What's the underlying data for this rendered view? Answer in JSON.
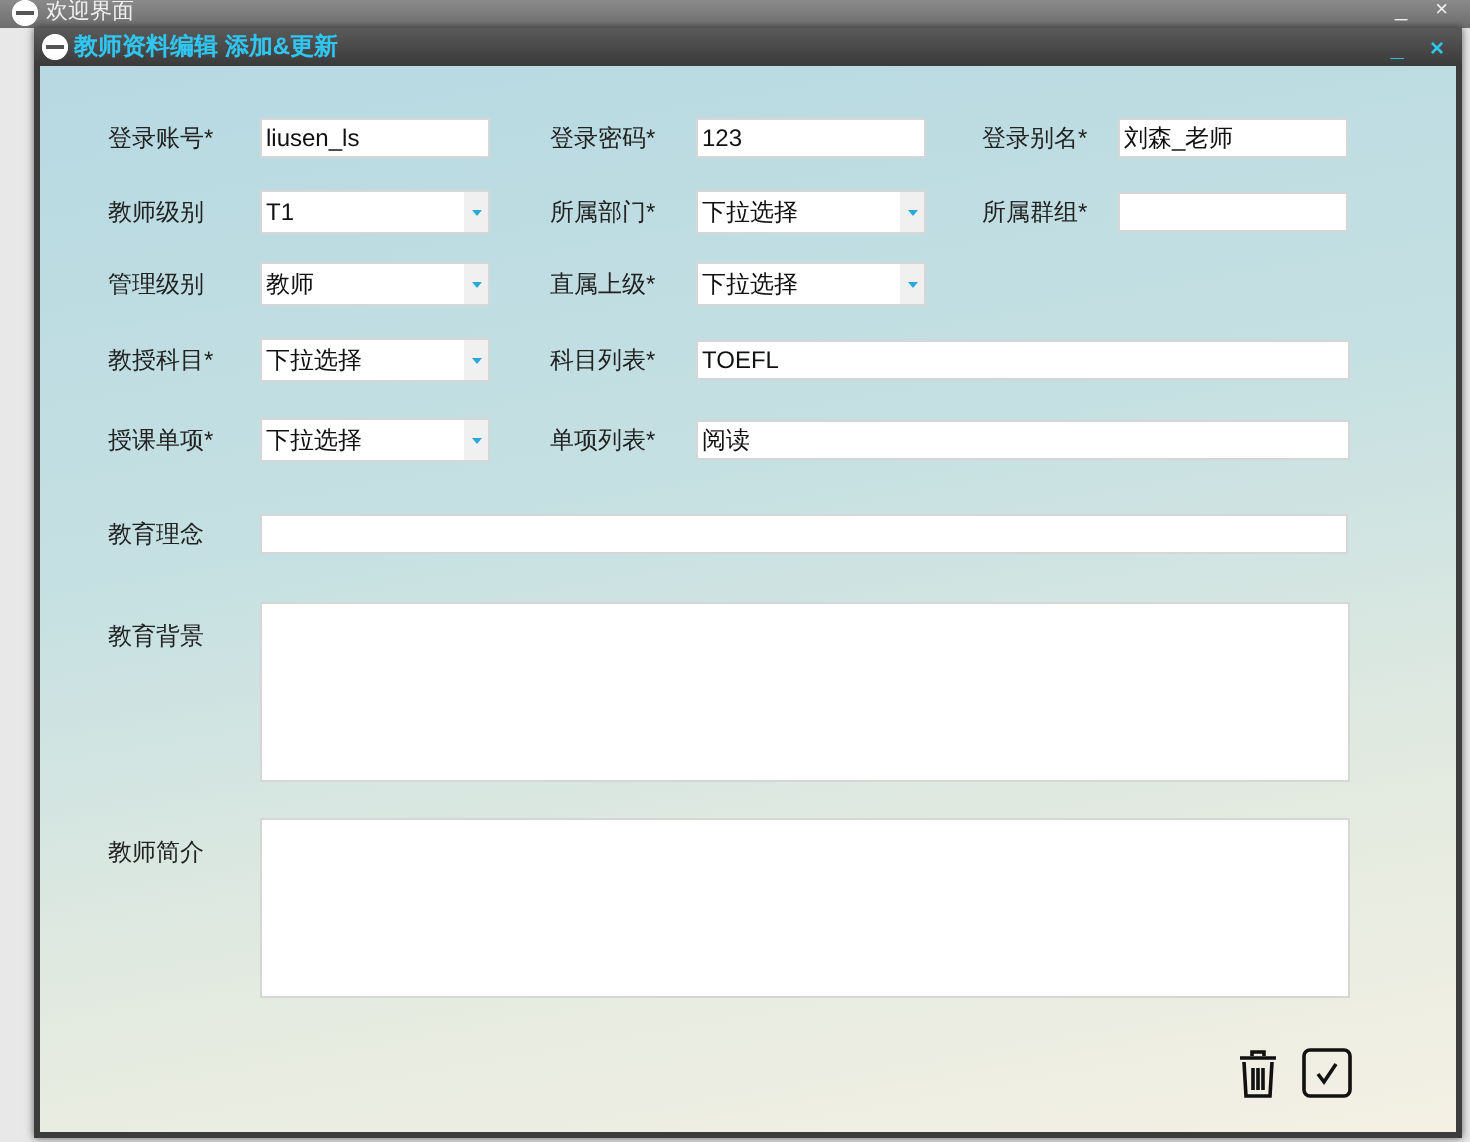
{
  "background_window": {
    "title": "欢迎界面",
    "buttons": [
      "_",
      "×"
    ]
  },
  "window": {
    "title": "教师资料编辑 添加&更新",
    "buttons": [
      "_",
      "×"
    ]
  },
  "rows": [
    [
      {
        "kind": "text",
        "label": "登录账号*",
        "value": "liusen_ls"
      },
      {
        "kind": "text",
        "label": "登录密码*",
        "value": "123"
      },
      {
        "kind": "text",
        "label": "登录别名*",
        "value": "刘森_老师"
      }
    ],
    [
      {
        "kind": "dropdown",
        "label": "教师级别",
        "value": "T1"
      },
      {
        "kind": "dropdown",
        "label": "所属部门*",
        "value": "下拉选择"
      },
      {
        "kind": "text",
        "label": "所属群组*"
      }
    ],
    [
      {
        "kind": "dropdown",
        "label": "管理级别",
        "value": "教师"
      },
      {
        "kind": "dropdown",
        "label": "直属上级*",
        "value": "下拉选择"
      }
    ],
    [
      {
        "kind": "dropdown",
        "label": "教授科目*",
        "value": "下拉选择"
      },
      {
        "kind": "wide_text",
        "label": "科目列表*",
        "value": "TOEFL"
      }
    ],
    [
      {
        "kind": "dropdown",
        "label": "授课单项*",
        "value": "下拉选择"
      },
      {
        "kind": "wide_text",
        "label": "单项列表*",
        "value": "阅读"
      }
    ],
    [
      {
        "kind": "wide_text",
        "label": "教育理念"
      }
    ],
    [
      {
        "kind": "textarea",
        "label": "教育背景"
      }
    ],
    [
      {
        "kind": "textarea",
        "label": "教师简介"
      }
    ]
  ]
}
